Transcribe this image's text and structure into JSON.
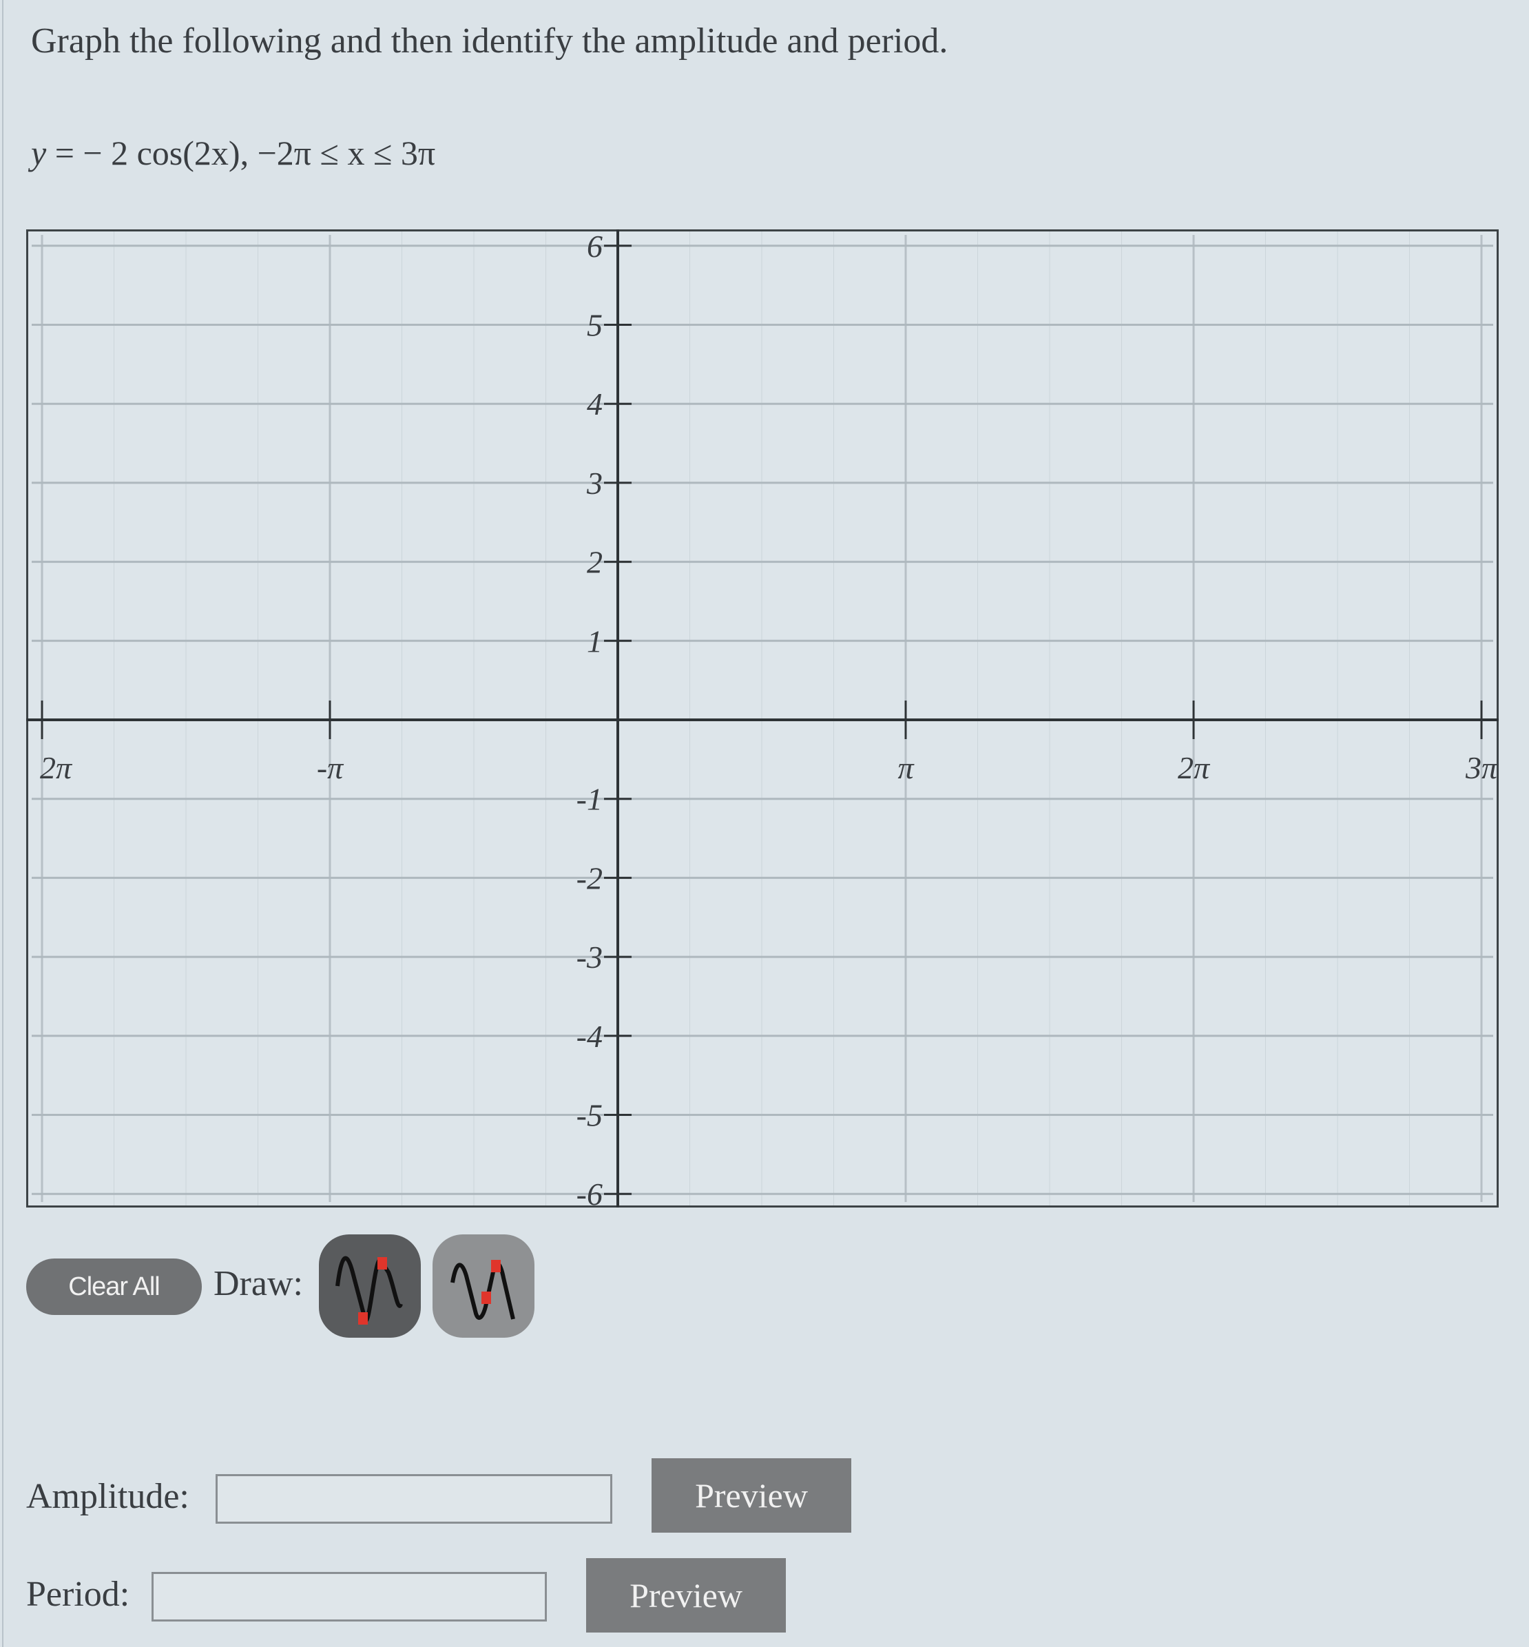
{
  "question": {
    "prompt": "Graph the following and then identify the amplitude and period.",
    "equation": {
      "lhs": "y",
      "equals": "=",
      "rhs": "− 2 cos(2x)",
      "separator": ",",
      "domain": "−2π ≤ x ≤ 3π"
    }
  },
  "graph": {
    "x_range_pi": [
      -2,
      3
    ],
    "y_range": [
      -6,
      6
    ],
    "x_ticks": [
      {
        "value_pi": -2,
        "label": "2π"
      },
      {
        "value_pi": -1,
        "label": "-π"
      },
      {
        "value_pi": 1,
        "label": "π"
      },
      {
        "value_pi": 2,
        "label": "2π"
      },
      {
        "value_pi": 3,
        "label": "3π"
      }
    ],
    "y_ticks": [
      {
        "value": 6,
        "label": "6"
      },
      {
        "value": 5,
        "label": "5"
      },
      {
        "value": 4,
        "label": "4"
      },
      {
        "value": 3,
        "label": "3"
      },
      {
        "value": 2,
        "label": "2"
      },
      {
        "value": 1,
        "label": "1"
      },
      {
        "value": -1,
        "label": "-1"
      },
      {
        "value": -2,
        "label": "-2"
      },
      {
        "value": -3,
        "label": "-3"
      },
      {
        "value": -4,
        "label": "-4"
      },
      {
        "value": -5,
        "label": "-5"
      },
      {
        "value": -6,
        "label": "-6"
      }
    ],
    "curve_drawn": false
  },
  "controls": {
    "clear_all_label": "Clear All",
    "draw_label": "Draw:",
    "tools": [
      {
        "name": "sine-peak-trough-tool",
        "selected": true
      },
      {
        "name": "sine-midline-peak-tool",
        "selected": false
      }
    ]
  },
  "answers": {
    "amplitude": {
      "label": "Amplitude:",
      "value": "",
      "placeholder": ""
    },
    "period": {
      "label": "Period:",
      "value": "",
      "placeholder": ""
    },
    "preview_label": "Preview"
  },
  "colors": {
    "background": "#dbe3e8",
    "button_gray": "#7a7c7e",
    "tool_selected": "#595b5d",
    "tool_unselected": "#8f9193",
    "point_red": "#e0352b"
  }
}
